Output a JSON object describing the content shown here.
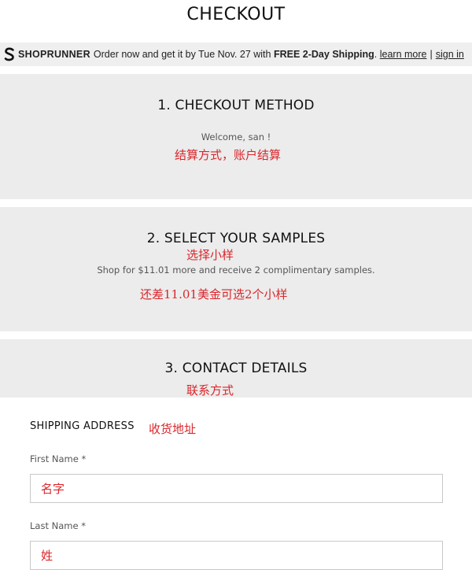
{
  "header": {
    "title": "CHECKOUT"
  },
  "shoprunner": {
    "brand": "SHOPRUNNER",
    "text_prefix": "Order now and get it by Tue Nov. 27 with ",
    "highlight": "FREE 2-Day Shipping",
    "text_suffix": ".",
    "learn_more": "learn more",
    "separator": "|",
    "sign_in": "sign in",
    "icon": "shoprunner-logo-icon"
  },
  "sections": {
    "checkout_method": {
      "heading": "1. CHECKOUT METHOD",
      "welcome": "Welcome, san !",
      "note": "结算方式，账户结算"
    },
    "samples": {
      "heading": "2. SELECT YOUR SAMPLES",
      "heading_note": "选择小样",
      "description": "Shop for $11.01 more and receive 2 complimentary samples.",
      "note": "还差11.01美金可选2个小样"
    },
    "contact": {
      "heading": "3. CONTACT DETAILS",
      "note": "联系方式"
    }
  },
  "shipping": {
    "title": "SHIPPING ADDRESS",
    "title_note": "收货地址",
    "first_name": {
      "label": "First Name *",
      "value": "名字"
    },
    "last_name": {
      "label": "Last Name *",
      "value": "姓"
    }
  },
  "colors": {
    "panel_bg": "#ececec",
    "annotation_red": "#d9262b",
    "input_border": "#c8c8c8"
  }
}
